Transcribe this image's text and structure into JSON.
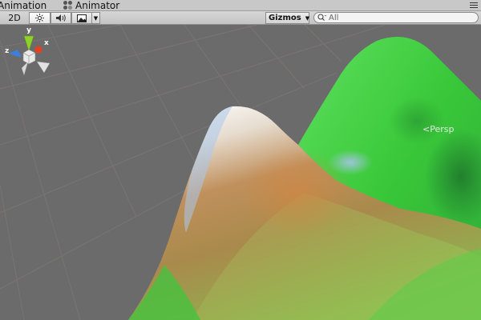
{
  "tabs": [
    {
      "label": "Animation",
      "icon": "animation-icon"
    },
    {
      "label": "Animator",
      "icon": "animator-icon"
    }
  ],
  "toolbar": {
    "mode_2d": "2D",
    "light_icon": "sun-icon",
    "audio_icon": "speaker-icon",
    "effects_icon": "image-icon",
    "gizmos_label": "Gizmos",
    "search_placeholder": "All"
  },
  "viewport": {
    "projection_label": "Persp",
    "axis_labels": {
      "x": "x",
      "y": "y",
      "z": "z"
    }
  },
  "colors": {
    "background": "#6b6b6b",
    "grid": "#7a7a7a",
    "terrain_green": "#3fcf3f",
    "terrain_brown": "#b3804a",
    "axis_x": "#e8401f",
    "axis_y": "#8dd12a",
    "axis_z": "#3d7fe0"
  }
}
